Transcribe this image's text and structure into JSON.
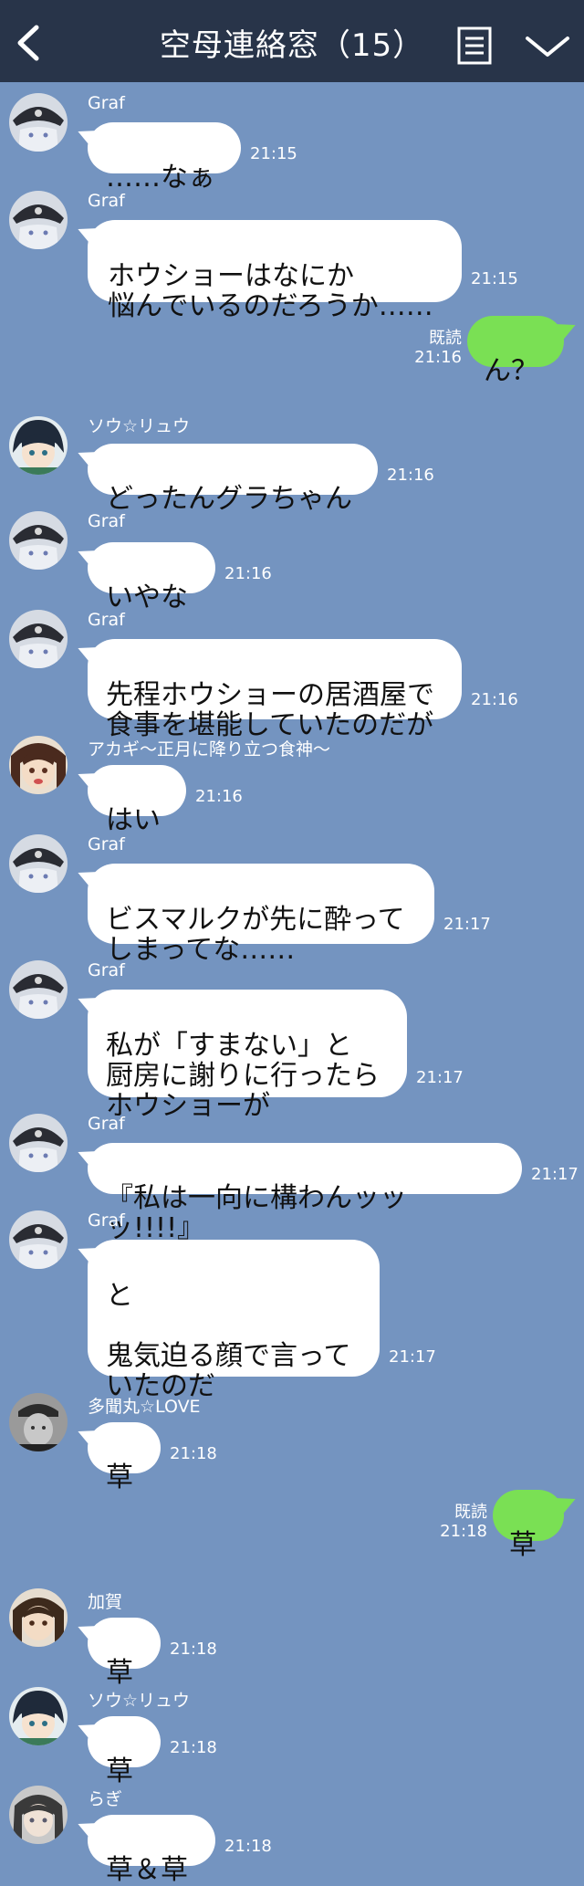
{
  "header": {
    "title": "空母連絡窓（15）"
  },
  "messages": [
    {
      "sender": "Graf",
      "text": "……なぁ",
      "time": "21:15"
    },
    {
      "sender": "Graf",
      "text": "ホウショーはなにか\n悩んでいるのだろうか……",
      "time": "21:15"
    },
    {
      "mine": true,
      "read": "既読",
      "text": "ん？",
      "time": "21:16"
    },
    {
      "sender": "ソウ☆リュウ",
      "text": "どったんグラちゃん",
      "time": "21:16"
    },
    {
      "sender": "Graf",
      "text": "いやな",
      "time": "21:16"
    },
    {
      "sender": "Graf",
      "text": "先程ホウショーの居酒屋で\n食事を堪能していたのだが",
      "time": "21:16"
    },
    {
      "sender": "アカギ〜正月に降り立つ食神〜",
      "text": "はい",
      "time": "21:16"
    },
    {
      "sender": "Graf",
      "text": "ビスマルクが先に酔って\nしまってな……",
      "time": "21:17"
    },
    {
      "sender": "Graf",
      "text": "私が「すまない」と\n厨房に謝りに行ったら\nホウショーが",
      "time": "21:17"
    },
    {
      "sender": "Graf",
      "text": "『私は一向に構わんッッッ!!!!』",
      "time": "21:17"
    },
    {
      "sender": "Graf",
      "text": "と\n\n鬼気迫る顔で言って\nいたのだ",
      "time": "21:17"
    },
    {
      "sender": "多聞丸☆LOVE",
      "text": "草",
      "time": "21:18"
    },
    {
      "mine": true,
      "read": "既読",
      "text": "草",
      "time": "21:18"
    },
    {
      "sender": "加賀",
      "text": "草",
      "time": "21:18"
    },
    {
      "sender": "ソウ☆リュウ",
      "text": "草",
      "time": "21:18"
    },
    {
      "sender": "らぎ",
      "text": "草＆草",
      "time": "21:18"
    }
  ]
}
